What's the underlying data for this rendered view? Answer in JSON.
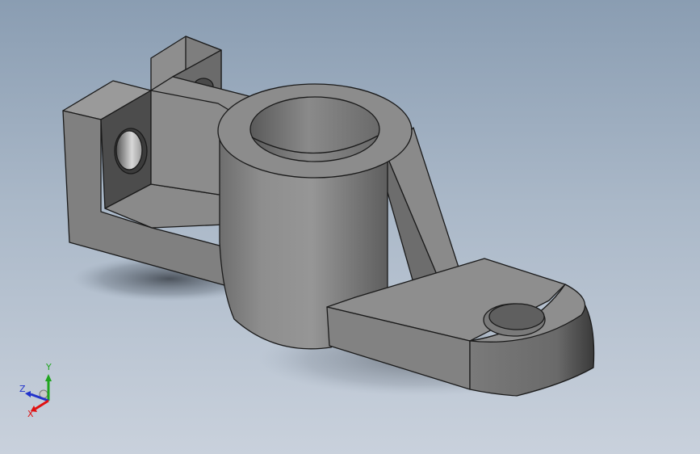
{
  "viewport": {
    "background_top": "#8a9db2",
    "background_bottom": "#c9d1dc"
  },
  "model": {
    "part_color": "#8c8c8c",
    "edge_color": "#1a1a1a"
  },
  "triad": {
    "x_label": "X",
    "y_label": "Y",
    "z_label": "Z",
    "x_color": "#e01010",
    "y_color": "#1fa51f",
    "z_color": "#2233cc"
  }
}
